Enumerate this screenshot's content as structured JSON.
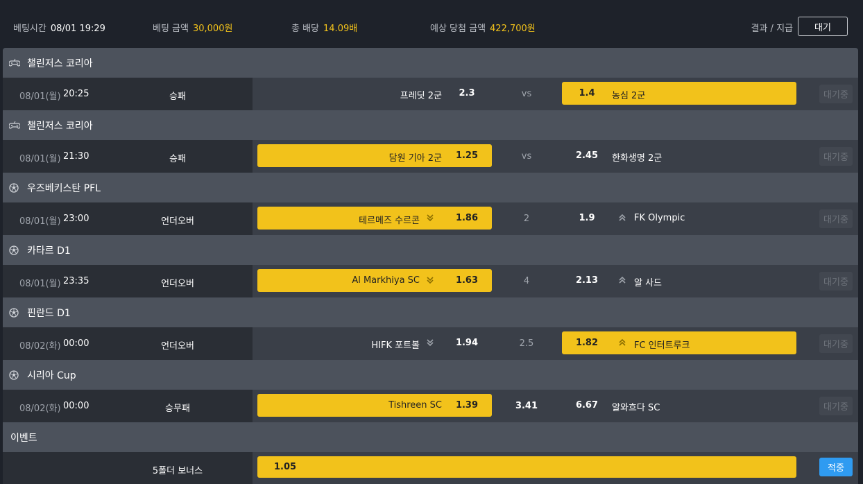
{
  "header": {
    "bet_time_label": "베팅시간",
    "bet_time_value": "08/01 19:29",
    "bet_amount_label": "베팅 금액",
    "bet_amount_value": "30,000원",
    "total_odds_label": "총 배당",
    "total_odds_value": "14.09배",
    "expected_win_label": "예상 당첨 금액",
    "expected_win_value": "422,700원",
    "result_label": "결과 / 지급",
    "status_button": "대기"
  },
  "colors": {
    "selected": "#f2c21b",
    "apply": "#2f9bf1",
    "league_bar": "#4c525c"
  },
  "bets": [
    {
      "league": "챌린저스 코리아",
      "league_icon": "gamepad-icon",
      "date": "08/01(월)",
      "time": "20:25",
      "bet_type": "승패",
      "home_team": "프레딧 2군",
      "home_odds": "2.3",
      "home_arrow": "",
      "middle": "vs",
      "away_odds": "1.4",
      "away_team": "농심 2군",
      "away_arrow": "",
      "selected": "away",
      "status": "대기중"
    },
    {
      "league": "챌린저스 코리아",
      "league_icon": "gamepad-icon",
      "date": "08/01(월)",
      "time": "21:30",
      "bet_type": "승패",
      "home_team": "담원 기아 2군",
      "home_odds": "1.25",
      "home_arrow": "",
      "middle": "vs",
      "away_odds": "2.45",
      "away_team": "한화생명 2군",
      "away_arrow": "",
      "selected": "home",
      "status": "대기중"
    },
    {
      "league": "우즈베키스탄 PFL",
      "league_icon": "soccer-ball-icon",
      "date": "08/01(월)",
      "time": "23:00",
      "bet_type": "언더오버",
      "home_team": "테르메즈 수르콘",
      "home_odds": "1.86",
      "home_arrow": "down",
      "middle": "2",
      "away_odds": "1.9",
      "away_team": "FK Olympic",
      "away_arrow": "up",
      "selected": "home",
      "status": "대기중"
    },
    {
      "league": "카타르 D1",
      "league_icon": "soccer-ball-icon",
      "date": "08/01(월)",
      "time": "23:35",
      "bet_type": "언더오버",
      "home_team": "Al Markhiya SC",
      "home_odds": "1.63",
      "home_arrow": "down",
      "middle": "4",
      "away_odds": "2.13",
      "away_team": "알 사드",
      "away_arrow": "up",
      "selected": "home",
      "status": "대기중"
    },
    {
      "league": "핀란드 D1",
      "league_icon": "soccer-ball-icon",
      "date": "08/02(화)",
      "time": "00:00",
      "bet_type": "언더오버",
      "home_team": "HIFK 포트볼",
      "home_odds": "1.94",
      "home_arrow": "down",
      "middle": "2.5",
      "away_odds": "1.82",
      "away_team": "FC 인터트루크",
      "away_arrow": "up",
      "selected": "away",
      "status": "대기중"
    },
    {
      "league": "시리아 Cup",
      "league_icon": "soccer-ball-icon",
      "date": "08/02(화)",
      "time": "00:00",
      "bet_type": "승무패",
      "home_team": "Tishreen SC",
      "home_odds": "1.39",
      "home_arrow": "",
      "middle": "3.41",
      "away_odds": "6.67",
      "away_team": "알와흐다 SC",
      "away_arrow": "",
      "selected": "home",
      "status": "대기중"
    }
  ],
  "event": {
    "label": "이벤트",
    "bonus_name": "5폴더 보너스",
    "bonus_odds": "1.05",
    "apply_button": "적중"
  }
}
